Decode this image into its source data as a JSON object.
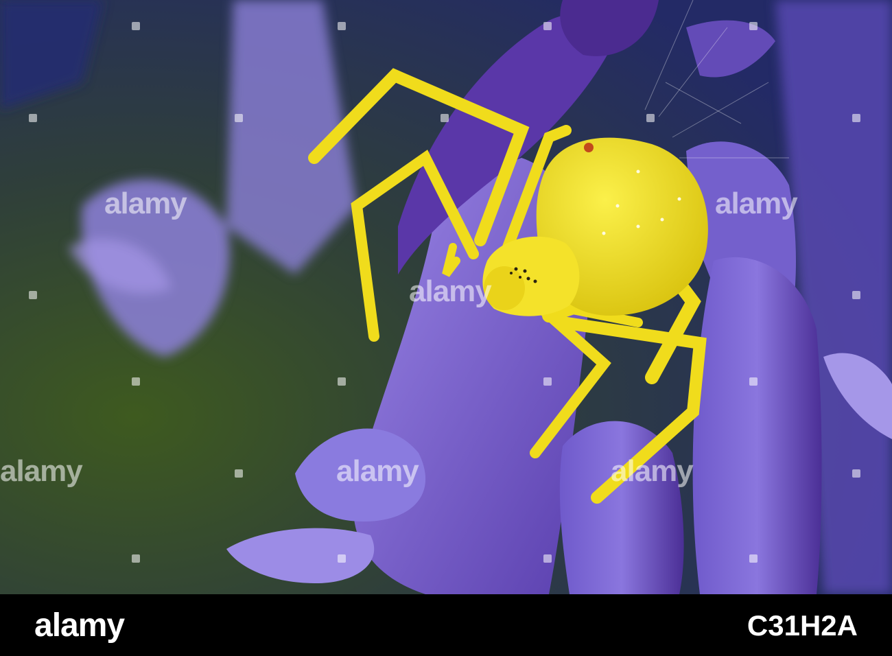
{
  "photo": {
    "subject": "yellow crab spider on purple bluebell flowers",
    "colors": {
      "background_dark": "#2c2f6b",
      "background_green": "#3f5a1e",
      "petal": "#7f6bd0",
      "petal_dark": "#4d2f8f",
      "spider": "#f2e020"
    }
  },
  "watermark": {
    "text": "alamy"
  },
  "footer": {
    "logo": "alamy",
    "image_id": "C31H2A"
  }
}
